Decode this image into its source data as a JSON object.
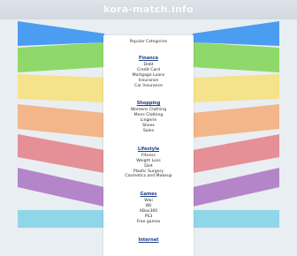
{
  "site": {
    "title": "kora-match.info"
  },
  "panel": {
    "heading": "Popular Categories",
    "categories": [
      {
        "title": "Finance",
        "links": [
          "Debt",
          "Credit Card",
          "Mortgage Loans",
          "Insurance",
          "Car Insurance"
        ]
      },
      {
        "title": "Shopping",
        "links": [
          "Womens Clothing",
          "Mens Clothing",
          "Lingerie",
          "Shoes",
          "Sales"
        ]
      },
      {
        "title": "Lifestyle",
        "links": [
          "Fitness",
          "Weight Loss",
          "Diet",
          "Plastic Surgery",
          "Cosmetics and Makeup"
        ]
      },
      {
        "title": "Games",
        "links": [
          "Wwi",
          "Wii",
          "XBox360",
          "PS3",
          "Free games"
        ]
      },
      {
        "title": "Internet",
        "links": []
      }
    ]
  },
  "colors": {
    "wing_blue": "#4a9df0",
    "wing_green": "#8fd86a",
    "wing_yellow": "#f5e28a",
    "wing_orange": "#f3b68a",
    "wing_pink": "#e58f96",
    "wing_purple": "#b486c9",
    "wing_cyan": "#8fd7e8"
  }
}
